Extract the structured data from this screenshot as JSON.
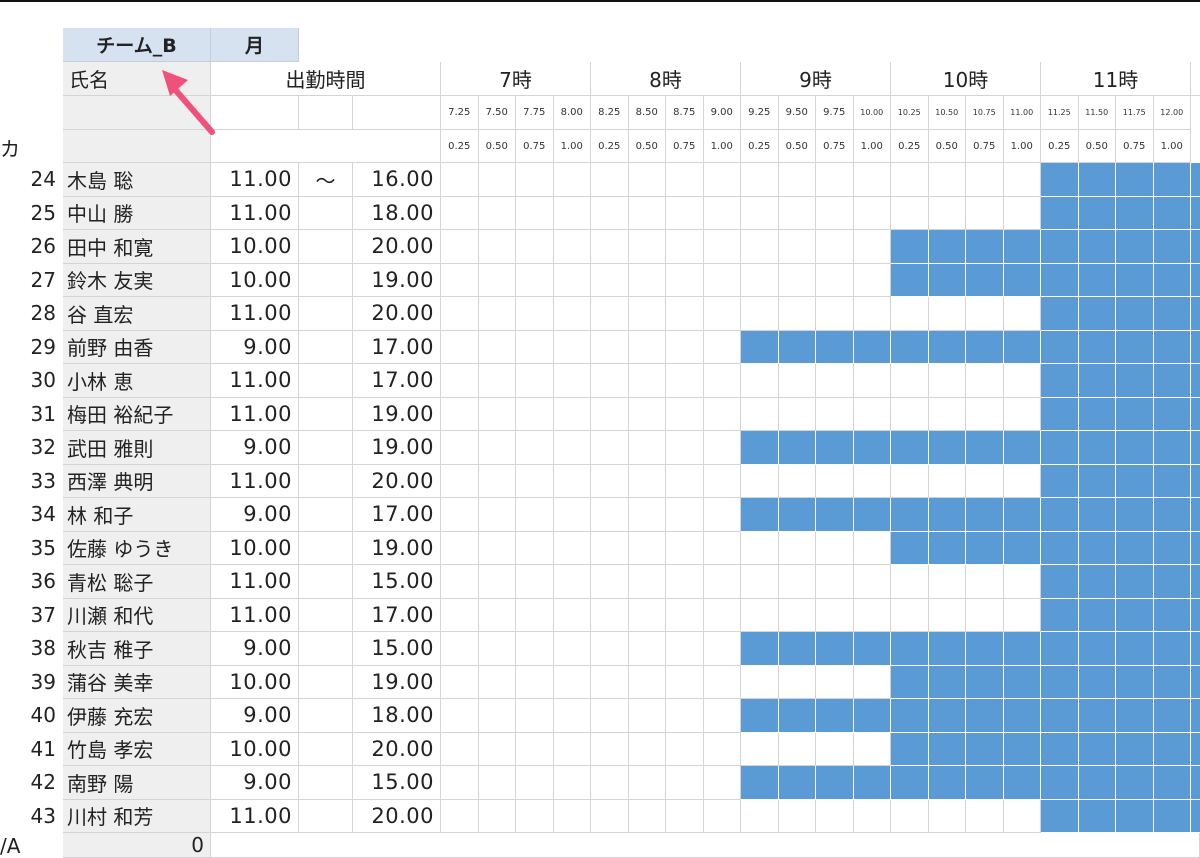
{
  "team": {
    "name": "チーム_B",
    "day": "月"
  },
  "header": {
    "name_label": "氏名",
    "work_hours_label": "出勤時間",
    "tilde": "～",
    "hours": [
      "7時",
      "8時",
      "9時",
      "10時",
      "11時"
    ],
    "quarter_labels": [
      "7.25",
      "7.50",
      "7.75",
      "8.00",
      "8.25",
      "8.50",
      "8.75",
      "9.00",
      "9.25",
      "9.50",
      "9.75",
      "10.00",
      "10.25",
      "10.50",
      "10.75",
      "11.00",
      "11.25",
      "11.50",
      "11.75",
      "12.00"
    ],
    "fraction_labels": [
      "0.25",
      "0.50",
      "0.75",
      "1.00",
      "0.25",
      "0.50",
      "0.75",
      "1.00",
      "0.25",
      "0.50",
      "0.75",
      "1.00",
      "0.25",
      "0.50",
      "0.75",
      "1.00",
      "0.25",
      "0.50",
      "0.75",
      "1.00"
    ]
  },
  "left_edge": {
    "label_top": "カ",
    "label_bottom": "/A"
  },
  "employees": [
    {
      "no": "24",
      "name": "木島 聡",
      "start": "11.00",
      "end": "16.00"
    },
    {
      "no": "25",
      "name": "中山 勝",
      "start": "11.00",
      "end": "18.00"
    },
    {
      "no": "26",
      "name": "田中 和寛",
      "start": "10.00",
      "end": "20.00"
    },
    {
      "no": "27",
      "name": "鈴木 友実",
      "start": "10.00",
      "end": "19.00"
    },
    {
      "no": "28",
      "name": "谷 直宏",
      "start": "11.00",
      "end": "20.00"
    },
    {
      "no": "29",
      "name": "前野 由香",
      "start": "9.00",
      "end": "17.00"
    },
    {
      "no": "30",
      "name": "小林 恵",
      "start": "11.00",
      "end": "17.00"
    },
    {
      "no": "31",
      "name": "梅田 裕紀子",
      "start": "11.00",
      "end": "19.00"
    },
    {
      "no": "32",
      "name": "武田 雅則",
      "start": "9.00",
      "end": "19.00"
    },
    {
      "no": "33",
      "name": "西澤 典明",
      "start": "11.00",
      "end": "20.00"
    },
    {
      "no": "34",
      "name": "林 和子",
      "start": "9.00",
      "end": "17.00"
    },
    {
      "no": "35",
      "name": "佐藤 ゆうき",
      "start": "10.00",
      "end": "19.00"
    },
    {
      "no": "36",
      "name": "青松 聡子",
      "start": "11.00",
      "end": "15.00"
    },
    {
      "no": "37",
      "name": "川瀬 和代",
      "start": "11.00",
      "end": "17.00"
    },
    {
      "no": "38",
      "name": "秋吉 稚子",
      "start": "9.00",
      "end": "15.00"
    },
    {
      "no": "39",
      "name": "蒲谷 美幸",
      "start": "10.00",
      "end": "19.00"
    },
    {
      "no": "40",
      "name": "伊藤 充宏",
      "start": "9.00",
      "end": "18.00"
    },
    {
      "no": "41",
      "name": "竹島 孝宏",
      "start": "10.00",
      "end": "20.00"
    },
    {
      "no": "42",
      "name": "南野 陽",
      "start": "9.00",
      "end": "15.00"
    },
    {
      "no": "43",
      "name": "川村 和芳",
      "start": "11.00",
      "end": "20.00"
    }
  ],
  "footer": {
    "total_value": "0"
  },
  "colors": {
    "shift_fill": "#5b9bd5",
    "team_header": "#d7e2f1",
    "name_column": "#efefef"
  },
  "annotation": {
    "icon": "pink-arrow-icon",
    "color": "#f0517a"
  }
}
